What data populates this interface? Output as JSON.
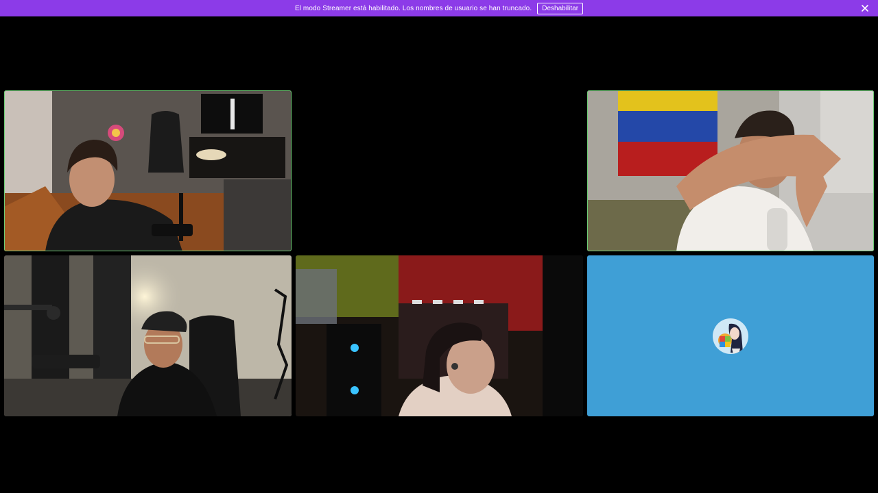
{
  "banner": {
    "message": "El modo Streamer está habilitado. Los nombres de usuario se han truncado.",
    "disable_label": "Deshabilitar",
    "close_icon": "close-icon",
    "background": "#8c3be8"
  },
  "stage": {
    "tiles": [
      {
        "id": "tile-1",
        "kind": "video",
        "speaking": true
      },
      {
        "id": "tile-2",
        "kind": "video",
        "speaking": true
      },
      {
        "id": "tile-3",
        "kind": "video",
        "speaking": false
      },
      {
        "id": "tile-4",
        "kind": "video",
        "speaking": false
      },
      {
        "id": "tile-5",
        "kind": "avatar",
        "speaking": false,
        "background": "#3f9fd6"
      }
    ],
    "speaking_color": "#6fce76"
  }
}
